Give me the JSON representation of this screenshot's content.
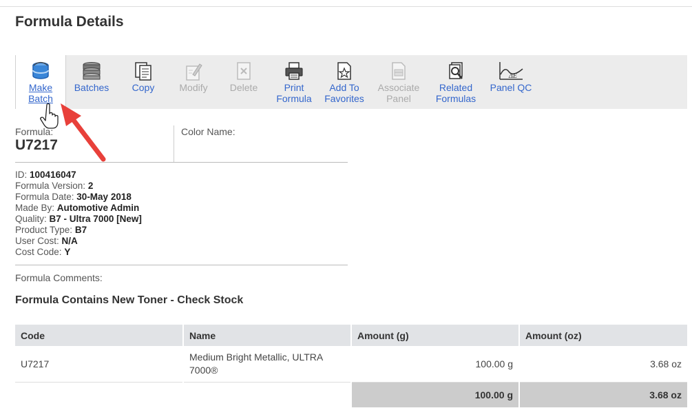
{
  "page": {
    "title": "Formula Details"
  },
  "toolbar": {
    "items": [
      {
        "label": "Make\nBatch",
        "icon": "paint-can-icon",
        "enabled": true,
        "active": true
      },
      {
        "label": "Batches",
        "icon": "batches-stack-icon",
        "enabled": true
      },
      {
        "label": "Copy",
        "icon": "copy-icon",
        "enabled": true
      },
      {
        "label": "Modify",
        "icon": "modify-icon",
        "enabled": false
      },
      {
        "label": "Delete",
        "icon": "delete-icon",
        "enabled": false
      },
      {
        "label": "Print\nFormula",
        "icon": "printer-icon",
        "enabled": true
      },
      {
        "label": "Add To\nFavorites",
        "icon": "star-document-icon",
        "enabled": true
      },
      {
        "label": "Associate\nPanel",
        "icon": "associate-panel-icon",
        "enabled": false
      },
      {
        "label": "Related\nFormulas",
        "icon": "search-documents-icon",
        "enabled": true
      },
      {
        "label": "Panel QC",
        "icon": "delta-e-chart-icon",
        "enabled": true
      }
    ],
    "colors": {
      "link": "#3366cc",
      "disabled": "#aaaaaa",
      "background": "#ececec"
    }
  },
  "formula": {
    "label": "Formula:",
    "code": "U7217",
    "color_name_label": "Color Name:",
    "color_name": ""
  },
  "details": [
    {
      "label": "ID:",
      "value": "100416047"
    },
    {
      "label": "Formula Version:",
      "value": "2"
    },
    {
      "label": "Formula Date:",
      "value": "30-May 2018"
    },
    {
      "label": "Made By:",
      "value": "Automotive Admin"
    },
    {
      "label": "Quality:",
      "value": "B7 - Ultra 7000 [New]"
    },
    {
      "label": "Product Type:",
      "value": "B7"
    },
    {
      "label": "User Cost:",
      "value": "N/A"
    },
    {
      "label": "Cost Code:",
      "value": "Y"
    }
  ],
  "comments": {
    "label": "Formula Comments:",
    "warning": "Formula Contains New Toner - Check Stock"
  },
  "table": {
    "headers": [
      "Code",
      "Name",
      "Amount (g)",
      "Amount (oz)"
    ],
    "rows": [
      {
        "code": "U7217",
        "name": "Medium Bright Metallic, ULTRA 7000®",
        "amount_g": "100.00 g",
        "amount_oz": "3.68 oz"
      }
    ],
    "totals": {
      "amount_g": "100.00 g",
      "amount_oz": "3.68 oz"
    }
  },
  "annotation": {
    "arrow_color": "#e8403a"
  }
}
